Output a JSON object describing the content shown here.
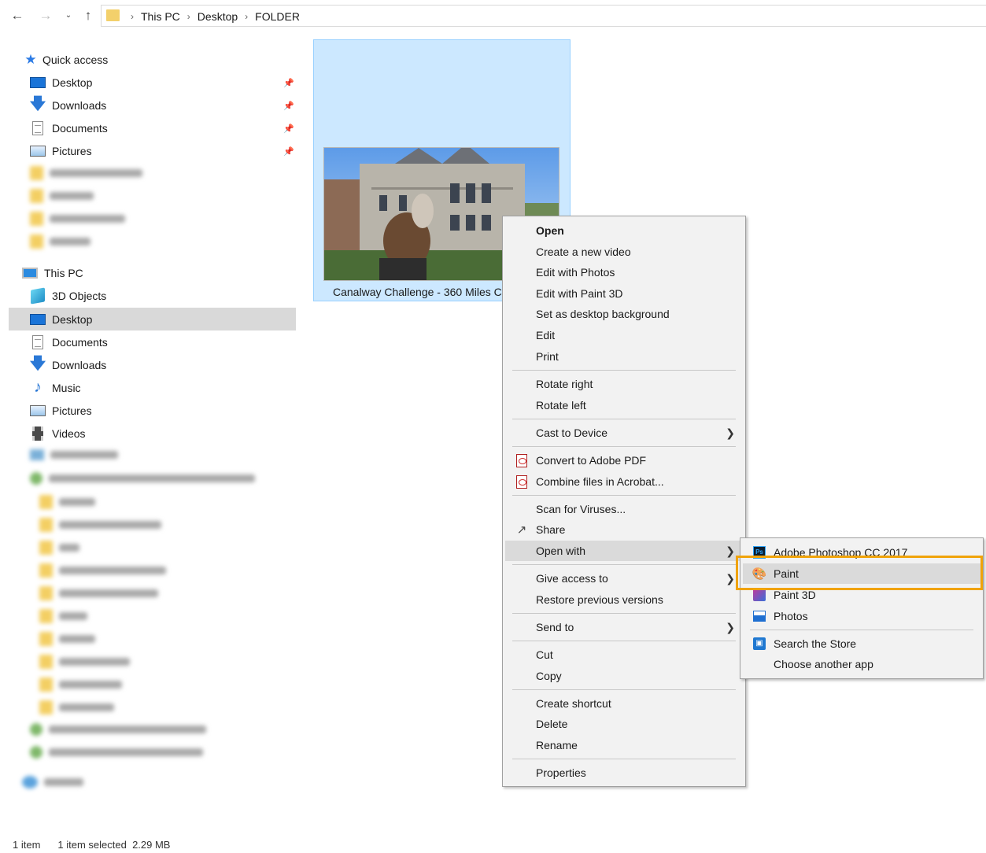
{
  "address_bar": {
    "crumbs": [
      "This PC",
      "Desktop",
      "FOLDER"
    ],
    "back_icon": "arrow-left-icon",
    "forward_icon": "arrow-right-icon",
    "recent_icon": "chevron-down-icon",
    "up_icon": "arrow-up-icon"
  },
  "sidebar": {
    "quick_access_label": "Quick access",
    "quick_access_items": [
      {
        "label": "Desktop",
        "icon": "desktop-icon",
        "pinned": true
      },
      {
        "label": "Downloads",
        "icon": "download-arrow-icon",
        "pinned": true
      },
      {
        "label": "Documents",
        "icon": "document-icon",
        "pinned": true
      },
      {
        "label": "Pictures",
        "icon": "pictures-icon",
        "pinned": true
      }
    ],
    "this_pc_label": "This PC",
    "this_pc_items": [
      {
        "label": "3D Objects",
        "icon": "cube-icon"
      },
      {
        "label": "Desktop",
        "icon": "desktop-icon",
        "selected": true
      },
      {
        "label": "Documents",
        "icon": "document-icon"
      },
      {
        "label": "Downloads",
        "icon": "download-arrow-icon"
      },
      {
        "label": "Music",
        "icon": "music-note-icon"
      },
      {
        "label": "Pictures",
        "icon": "pictures-icon"
      },
      {
        "label": "Videos",
        "icon": "film-icon"
      }
    ]
  },
  "status_bar": {
    "item_count": "1 item",
    "selection": "1 item selected  2.29 MB"
  },
  "file_tile": {
    "caption": "Canalway Challenge - 360 Miles C"
  },
  "context_menu": {
    "open": "Open",
    "create_video": "Create a new video",
    "edit_photos": "Edit with Photos",
    "edit_paint3d": "Edit with Paint 3D",
    "set_background": "Set as desktop background",
    "edit": "Edit",
    "print": "Print",
    "rotate_right": "Rotate right",
    "rotate_left": "Rotate left",
    "cast": "Cast to Device",
    "convert_pdf": "Convert to Adobe PDF",
    "combine_acrobat": "Combine files in Acrobat...",
    "scan_viruses": "Scan for Viruses...",
    "share": "Share",
    "open_with": "Open with",
    "give_access": "Give access to",
    "restore_versions": "Restore previous versions",
    "send_to": "Send to",
    "cut": "Cut",
    "copy": "Copy",
    "create_shortcut": "Create shortcut",
    "delete": "Delete",
    "rename": "Rename",
    "properties": "Properties"
  },
  "open_with_menu": {
    "photoshop": "Adobe Photoshop CC 2017",
    "paint": "Paint",
    "paint3d": "Paint 3D",
    "photos": "Photos",
    "search_store": "Search the Store",
    "choose_app": "Choose another app"
  },
  "colors": {
    "selection_fill": "#cce8ff",
    "highlight_outline": "#f0a30a",
    "menu_background": "#f2f2f2"
  }
}
